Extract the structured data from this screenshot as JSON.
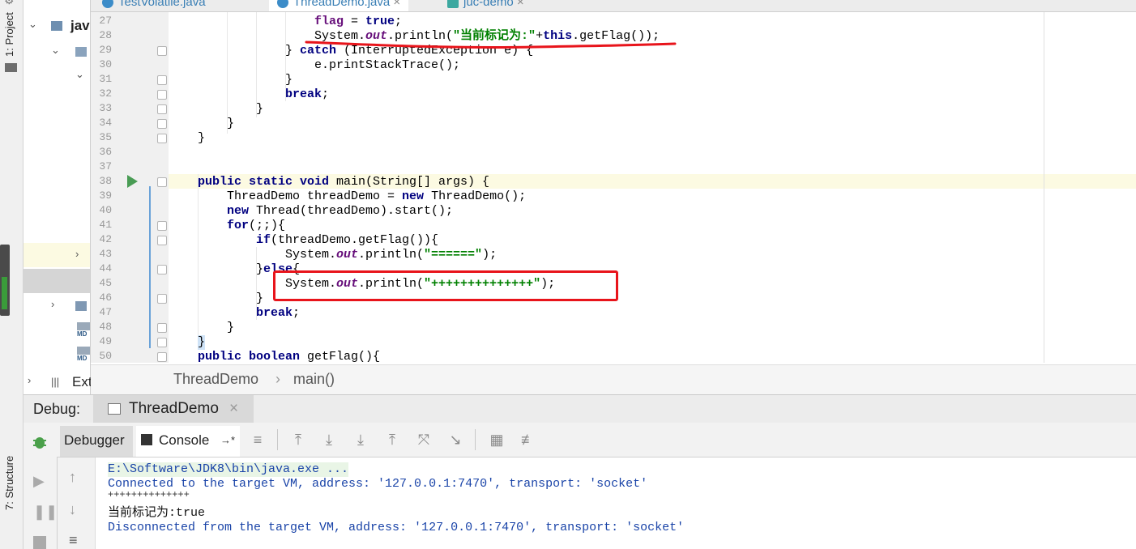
{
  "tabs": [
    {
      "label": "TestVolatile.java"
    },
    {
      "label": "ThreadDemo.java",
      "close": "×"
    },
    {
      "label": "juc-demo",
      "close": "×"
    }
  ],
  "sidebar": {
    "project_label": "1: Project",
    "structure_label": "7: Structure",
    "tree_top_label": "jav",
    "tree_bottom_label": "Ext",
    "md_badge": "MD"
  },
  "code": {
    "line_numbers": [
      "27",
      "28",
      "29",
      "30",
      "31",
      "32",
      "33",
      "34",
      "35",
      "36",
      "37",
      "38",
      "39",
      "40",
      "41",
      "42",
      "43",
      "44",
      "45",
      "46",
      "47",
      "48",
      "49",
      "50"
    ],
    "l27": {
      "kw": "flag",
      "rest": " = ",
      "kw2": "true",
      "end": ";"
    },
    "l28": {
      "cls": "System.",
      "out": "out",
      "call": ".println(",
      "str": "\"当前标记为:\"",
      "plus": "+",
      "kw": "this",
      "end": ".getFlag());"
    },
    "l29": {
      "brace": "} ",
      "kw": "catch",
      "rest": " (InterruptedException e) {"
    },
    "l30": "e.printStackTrace();",
    "l31": "}",
    "l32": {
      "kw": "break",
      "end": ";"
    },
    "l33": "}",
    "l34": "}",
    "l35": "}",
    "l38": {
      "kw": "public static void",
      "rest": " main(String[] args) {"
    },
    "l39": {
      "pre": "ThreadDemo threadDemo = ",
      "kw": "new",
      "rest": " ThreadDemo();"
    },
    "l40": {
      "kw": "new",
      "rest": " Thread(threadDemo).start();"
    },
    "l41": {
      "kw": "for",
      "rest": "(;;){"
    },
    "l42": {
      "kw": "if",
      "rest": "(threadDemo.getFlag()){"
    },
    "l43": {
      "cls": "System.",
      "out": "out",
      "call": ".println(",
      "str": "\"======\"",
      "end": ");"
    },
    "l44": {
      "brace": "}",
      "kw": "else",
      "end": "{"
    },
    "l45": {
      "cls": "System.",
      "out": "out",
      "call": ".println(",
      "str": "\"++++++++++++++\"",
      "end": ");"
    },
    "l46": "}",
    "l47": {
      "kw": "break",
      "end": ";"
    },
    "l48": "}",
    "l49": "}",
    "l50": {
      "kw": "public boolean",
      "rest": " getFlag(){"
    }
  },
  "breadcrumb": {
    "class_name": "ThreadDemo",
    "sep": "›",
    "method": "main()"
  },
  "debug": {
    "label": "Debug:",
    "session_tab": "ThreadDemo",
    "session_close": "×",
    "debugger_tab": "Debugger",
    "console_tab": "Console",
    "console_tab_arrow": "→*"
  },
  "console": {
    "line1": "E:\\Software\\JDK8\\bin\\java.exe ...",
    "line2": "Connected to the target VM, address: '127.0.0.1:7470', transport: 'socket'",
    "line3": "++++++++++++++",
    "line4": "当前标记为:true",
    "line5": "Disconnected from the target VM, address: '127.0.0.1:7470', transport: 'socket'"
  },
  "colors": {
    "keyword": "#000080",
    "string": "#008000",
    "field": "#660e7a",
    "annotation_red": "#e8141b",
    "console_blue": "#1a44a8"
  }
}
